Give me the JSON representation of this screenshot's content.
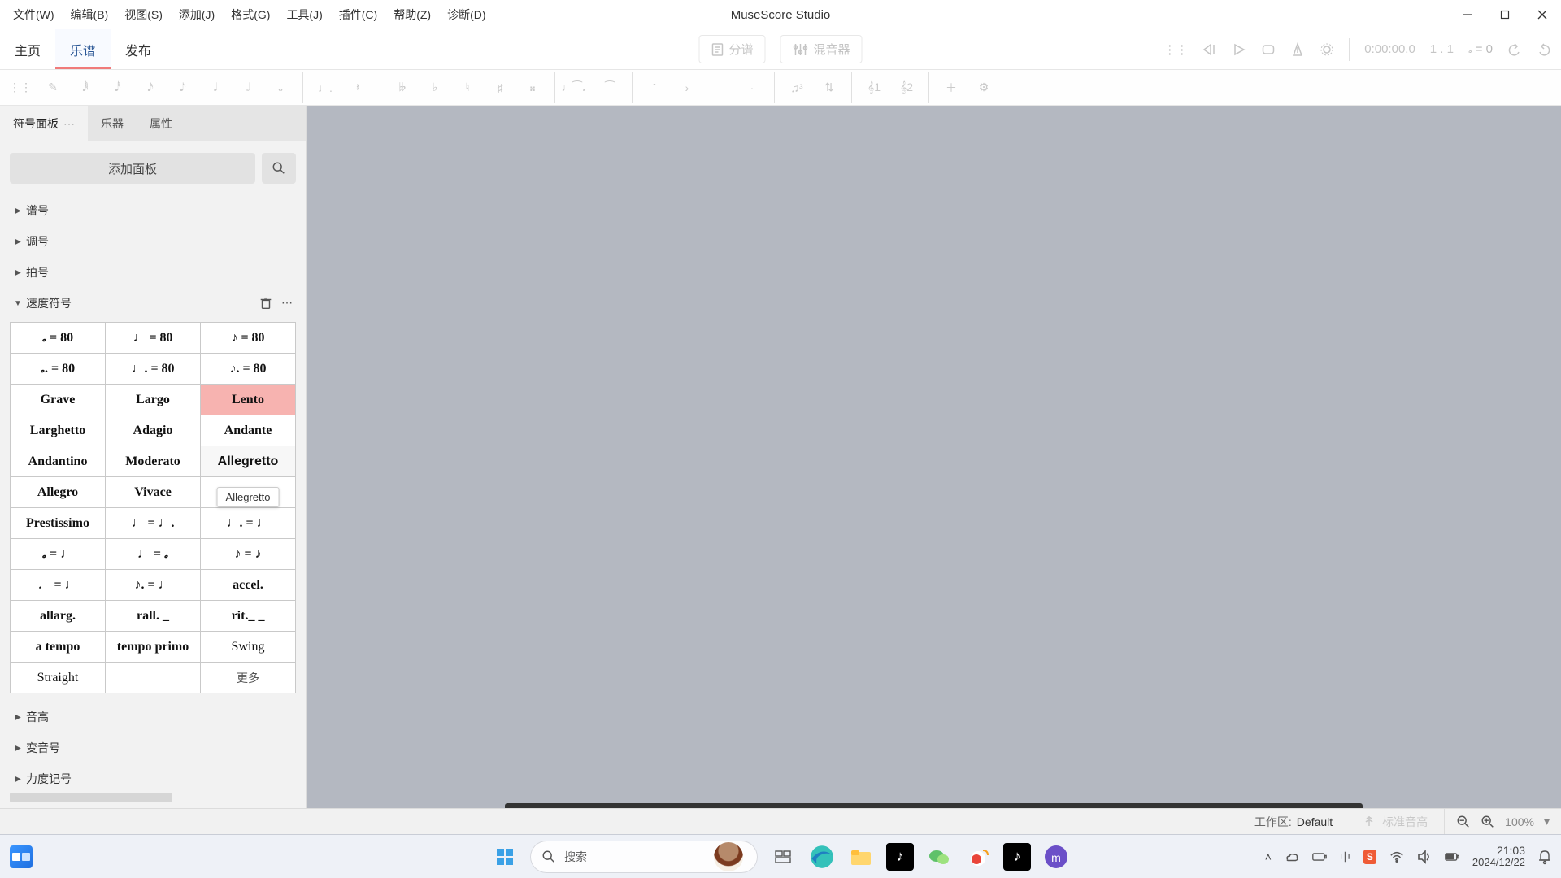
{
  "titlebar": {
    "app_title": "MuseScore Studio"
  },
  "menu": [
    "文件(W)",
    "编辑(B)",
    "视图(S)",
    "添加(J)",
    "格式(G)",
    "工具(J)",
    "插件(C)",
    "帮助(Z)",
    "诊断(D)"
  ],
  "maintabs": {
    "home": "主页",
    "score": "乐谱",
    "publish": "发布"
  },
  "center_buttons": {
    "parts": "分谱",
    "mixer": "混音器"
  },
  "transport": {
    "time": "0:00:00.0",
    "measure": "1 . 1",
    "tempo_label": "= 0"
  },
  "sidebar": {
    "tabs": [
      "符号面板",
      "乐器",
      "属性"
    ],
    "add_panel": "添加面板",
    "sections": {
      "clefs": "谱号",
      "keys": "调号",
      "timesig": "拍号",
      "tempo": "速度符号",
      "pitch": "音高",
      "accidentals": "变音号",
      "dynamics": "力度记号"
    }
  },
  "tempo": {
    "more": "更多",
    "tooltip": "Allegretto",
    "cells": [
      [
        "𝅗 = 80",
        "♩ = 80",
        "♪ = 80"
      ],
      [
        "𝅗. = 80",
        "♩. = 80",
        "♪. = 80"
      ],
      [
        "Grave",
        "Largo",
        "Lento"
      ],
      [
        "Larghetto",
        "Adagio",
        "Andante"
      ],
      [
        "Andantino",
        "Moderato",
        "Allegretto"
      ],
      [
        "Allegro",
        "Vivace",
        ""
      ],
      [
        "Prestissimo",
        "♩ = ♩.",
        "♩. = ♩"
      ],
      [
        "𝅗 = ♩",
        "♩ = 𝅗",
        "♪ = ♪"
      ],
      [
        "♩ = ♩",
        "♪. = ♩",
        "accel."
      ],
      [
        "allarg.",
        "rall. _",
        "rit._ _"
      ],
      [
        "a tempo",
        "tempo primo",
        "Swing"
      ],
      [
        "Straight",
        "",
        "更多"
      ]
    ]
  },
  "status": {
    "ws_label": "工作区:",
    "ws_value": "Default",
    "concert": "标准音高",
    "zoom": "100%"
  },
  "taskbar": {
    "search": "搜索",
    "clock_time": "21:03",
    "clock_date": "2024/12/22"
  }
}
